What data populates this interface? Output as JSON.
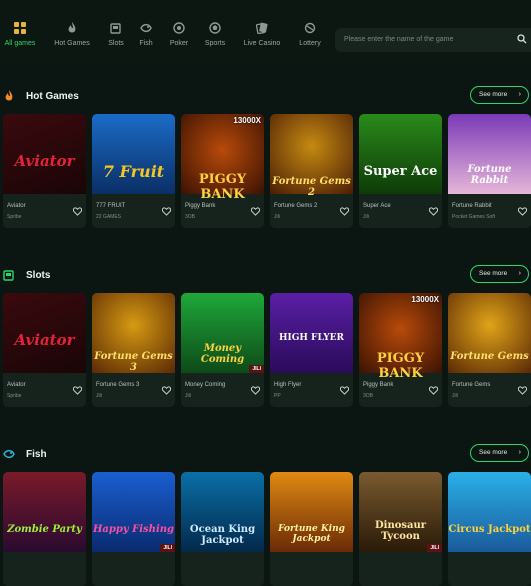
{
  "nav": {
    "items": [
      {
        "label": "All games",
        "icon": "grid-icon"
      },
      {
        "label": "Hot Games",
        "icon": "flame-icon"
      },
      {
        "label": "Slots",
        "icon": "slot-machine-icon"
      },
      {
        "label": "Fish",
        "icon": "fish-icon"
      },
      {
        "label": "Poker",
        "icon": "poker-chip-icon"
      },
      {
        "label": "Sports",
        "icon": "soccer-ball-icon"
      },
      {
        "label": "Live Casino",
        "icon": "cards-icon"
      },
      {
        "label": "Lottery",
        "icon": "lottery-ball-icon"
      }
    ],
    "search_placeholder": "Please enter the name of the game"
  },
  "colors": {
    "accent": "#2bd66b",
    "background": "#0b1511"
  },
  "sections": [
    {
      "title": "Hot Games",
      "icon": "flame-icon",
      "see_more": "See more",
      "cards": [
        {
          "name": "Aviator",
          "provider": "Spribe",
          "art": "Aviator"
        },
        {
          "name": "777 FRUIT",
          "provider": "22 GAMES",
          "art": "7 Fruit"
        },
        {
          "name": "Piggy Bank",
          "provider": "3OB",
          "art": "PIGGY BANK",
          "multiplier": "13000X"
        },
        {
          "name": "Fortune Gems 2",
          "provider": "Jili",
          "art": "Fortune Gems 2"
        },
        {
          "name": "Super Ace",
          "provider": "Jili",
          "art": "Super Ace"
        },
        {
          "name": "Fortune Rabbit",
          "provider": "Pocket Games Soft",
          "art": "Fortune Rabbit"
        }
      ]
    },
    {
      "title": "Slots",
      "icon": "slot-machine-icon",
      "see_more": "See more",
      "cards": [
        {
          "name": "Aviator",
          "provider": "Spribe",
          "art": "Aviator"
        },
        {
          "name": "Fortune Gems 3",
          "provider": "Jili",
          "art": "Fortune Gems 3"
        },
        {
          "name": "Money Coming",
          "provider": "Jili",
          "art": "Money Coming"
        },
        {
          "name": "High Flyer",
          "provider": "PP",
          "art": "HIGH FLYER"
        },
        {
          "name": "Piggy Bank",
          "provider": "3OB",
          "art": "PIGGY BANK",
          "multiplier": "13000X"
        },
        {
          "name": "Fortune Gems",
          "provider": "Jili",
          "art": "Fortune Gems"
        }
      ]
    },
    {
      "title": "Fish",
      "icon": "fish-icon",
      "see_more": "See more",
      "cards": [
        {
          "art": "Zombie Party"
        },
        {
          "art": "Happy Fishing"
        },
        {
          "art": "Ocean King Jackpot"
        },
        {
          "art": "Fortune King Jackpot"
        },
        {
          "art": "Dinosaur Tycoon"
        },
        {
          "art": "Circus Jackpot"
        }
      ]
    }
  ]
}
